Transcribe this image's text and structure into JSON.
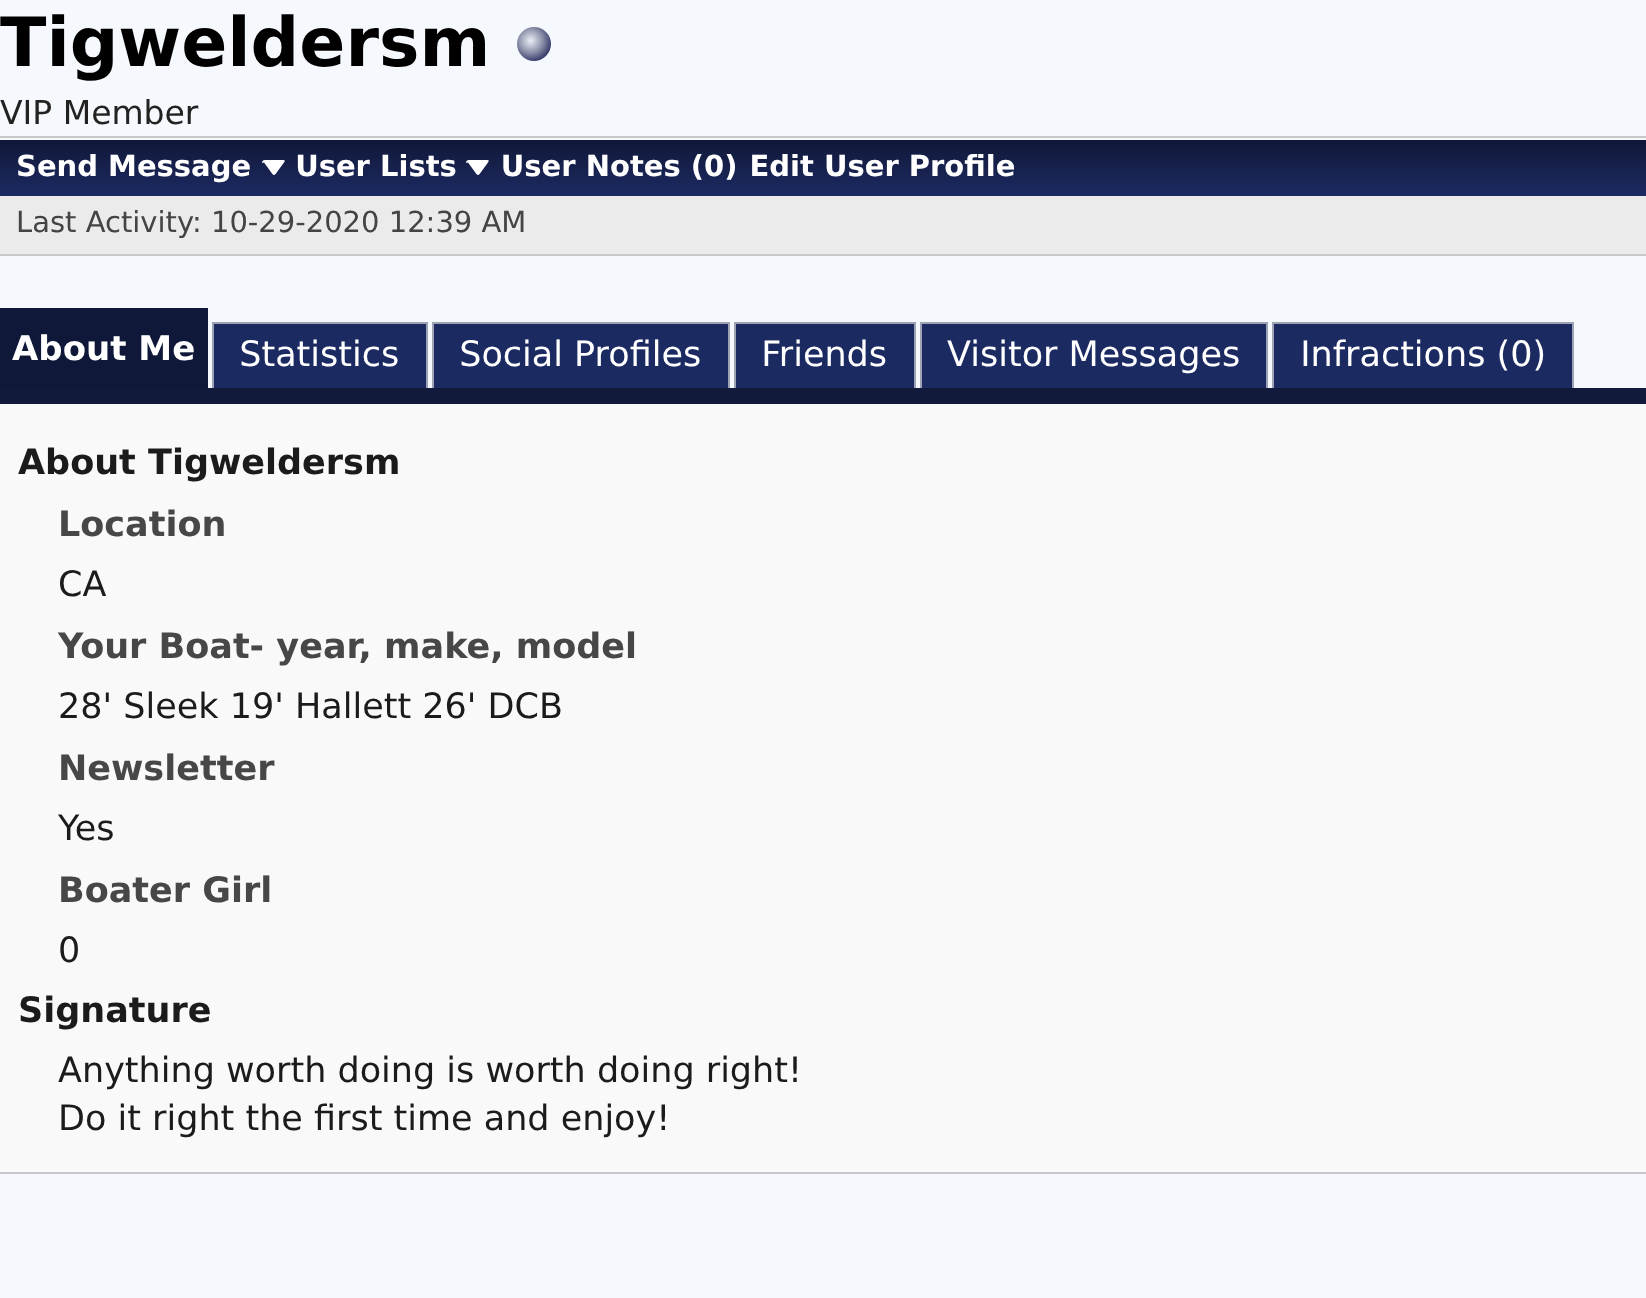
{
  "profile": {
    "username": "Tigweldersm",
    "online": false,
    "rank": "VIP Member"
  },
  "actions": [
    {
      "label": "Send Message",
      "dropdown": true
    },
    {
      "label": "User Lists",
      "dropdown": true
    },
    {
      "label": "User Notes (0)",
      "dropdown": false
    },
    {
      "label": "Edit User Profile",
      "dropdown": false
    }
  ],
  "last_activity": "Last Activity: 10-29-2020 12:39 AM",
  "tabs": [
    {
      "label": "About Me",
      "selected": true
    },
    {
      "label": "Statistics",
      "selected": false
    },
    {
      "label": "Social Profiles",
      "selected": false
    },
    {
      "label": "Friends",
      "selected": false
    },
    {
      "label": "Visitor Messages",
      "selected": false
    },
    {
      "label": "Infractions (0)",
      "selected": false
    }
  ],
  "about": {
    "heading": "About Tigweldersm",
    "fields": [
      {
        "label": "Location",
        "value": "CA"
      },
      {
        "label": "Your Boat- year, make, model",
        "value": "28' Sleek 19' Hallett 26' DCB"
      },
      {
        "label": "Newsletter",
        "value": "Yes"
      },
      {
        "label": "Boater Girl",
        "value": "0"
      }
    ]
  },
  "signature": {
    "heading": "Signature",
    "lines": [
      "Anything worth doing is worth doing right!",
      "Do it right the first time and enjoy!"
    ]
  }
}
